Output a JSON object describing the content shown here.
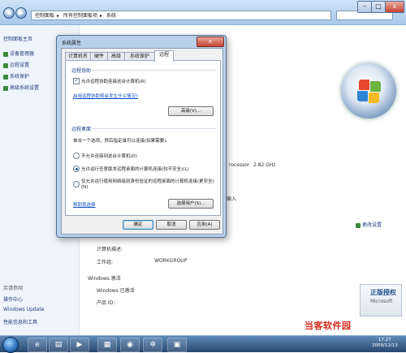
{
  "window": {
    "addressbar": [
      "控制面板",
      "所有控制面板项",
      "系统"
    ],
    "left_pane": {
      "home": "控制面板主页",
      "items": [
        "设备管理器",
        "远程设置",
        "系统保护",
        "高级系统设置"
      ],
      "see_also": "另请参阅",
      "see_also_items": [
        "操作中心",
        "Windows Update",
        "性能信息和工具"
      ]
    },
    "main": {
      "processor_label": "rocessor",
      "processor_speed": "2.82 GHz",
      "input_fragment": "输入",
      "change_settings": "更改设置",
      "computer_desc_label": "计算机描述:",
      "workgroup_label": "工作组:",
      "workgroup_value": "WORKGROUP",
      "activation_header": "Windows 激活",
      "activated": "Windows 已激活",
      "product_id_label": "产品 ID:",
      "genuine_badge": "正版授权",
      "genuine_sub": "Microsoft"
    }
  },
  "dialog": {
    "title": "系统属性",
    "close": "x",
    "tabs": [
      "计算机名",
      "硬件",
      "高级",
      "系统保护",
      "远程"
    ],
    "active_tab": 4,
    "remote_assistance": {
      "title": "远程协助",
      "checkbox_label": "允许远程协助连接这台计算机(R)",
      "checkbox_checked": true,
      "link": "启用远程协助将会发生什么情况?",
      "advanced_button": "高级(V)..."
    },
    "remote_desktop": {
      "title": "远程桌面",
      "instruction": "单击一个选项，然后指定谁可以连接(如果需要)。",
      "options": [
        "不允许连接到这台计算机(D)",
        "允许运行任意版本远程桌面的计算机连接(较不安全)(L)",
        "仅允许运行使用网络级别身份验证的远程桌面的计算机连接(更安全)(N)"
      ],
      "selected_option": 1,
      "help_link": "帮助我选择",
      "select_users_button": "选择用户(S)..."
    },
    "buttons": {
      "ok": "确定",
      "cancel": "取消",
      "apply": "应用(A)"
    }
  },
  "taskbar": {
    "time": "17:27",
    "date": "2009/12/13"
  },
  "watermark": "当客软件园"
}
